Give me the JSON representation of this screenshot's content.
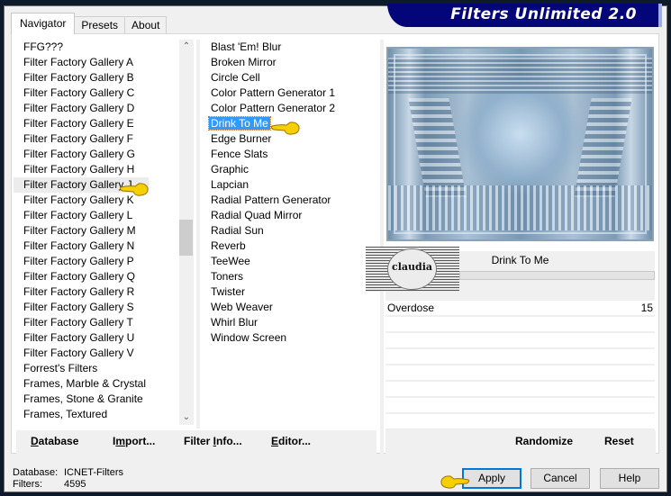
{
  "window": {
    "title": "Filters Unlimited 2.0"
  },
  "tabs": [
    {
      "label": "Navigator",
      "active": true
    },
    {
      "label": "Presets",
      "active": false
    },
    {
      "label": "About",
      "active": false
    }
  ],
  "categories": {
    "items": [
      "FFG???",
      "Filter Factory Gallery A",
      "Filter Factory Gallery B",
      "Filter Factory Gallery C",
      "Filter Factory Gallery D",
      "Filter Factory Gallery E",
      "Filter Factory Gallery F",
      "Filter Factory Gallery G",
      "Filter Factory Gallery H",
      "Filter Factory Gallery J",
      "Filter Factory Gallery K",
      "Filter Factory Gallery L",
      "Filter Factory Gallery M",
      "Filter Factory Gallery N",
      "Filter Factory Gallery P",
      "Filter Factory Gallery Q",
      "Filter Factory Gallery R",
      "Filter Factory Gallery S",
      "Filter Factory Gallery T",
      "Filter Factory Gallery U",
      "Filter Factory Gallery V",
      "Forrest's Filters",
      "Frames, Marble & Crystal",
      "Frames, Stone & Granite",
      "Frames, Textured"
    ],
    "highlighted": "Filter Factory Gallery J",
    "scroll_up_icon": "▲",
    "scroll_down_icon": "▼"
  },
  "filters": {
    "items": [
      "Blast 'Em! Blur",
      "Broken Mirror",
      "Circle Cell",
      "Color Pattern Generator 1",
      "Color Pattern Generator 2",
      "Drink To Me",
      "Edge Burner",
      "Fence Slats",
      "Graphic",
      "Lapcian",
      "Radial Pattern Generator",
      "Radial Quad Mirror",
      "Radial Sun",
      "Reverb",
      "TeeWee",
      "Toners",
      "Twister",
      "Web Weaver",
      "Whirl Blur",
      "Window Screen"
    ],
    "selected": "Drink To Me"
  },
  "watermark": {
    "text": "claudia"
  },
  "params": {
    "filter_name": "Drink To Me",
    "rows": [
      {
        "label": "Overdose",
        "value": "15"
      },
      {
        "label": "",
        "value": ""
      },
      {
        "label": "",
        "value": ""
      },
      {
        "label": "",
        "value": ""
      },
      {
        "label": "",
        "value": ""
      },
      {
        "label": "",
        "value": ""
      },
      {
        "label": "",
        "value": ""
      },
      {
        "label": "",
        "value": ""
      }
    ]
  },
  "toolbar_left": {
    "database": {
      "pre": "",
      "ul": "D",
      "post": "atabase"
    },
    "import": {
      "pre": "I",
      "ul": "m",
      "post": "port..."
    },
    "filter_info": {
      "pre": "Filter ",
      "ul": "I",
      "post": "nfo..."
    },
    "editor": {
      "pre": "",
      "ul": "E",
      "post": "ditor..."
    }
  },
  "toolbar_right": {
    "randomize": "Randomize",
    "reset": "Reset"
  },
  "status": {
    "database_label": "Database:",
    "database_value": "ICNET-Filters",
    "filters_label": "Filters:",
    "filters_value": "4595"
  },
  "buttons": {
    "apply": "Apply",
    "cancel": "Cancel",
    "help": "Help"
  },
  "colors": {
    "banner": "#05057a",
    "selection": "#3399ff",
    "default_button_border": "#0078d7",
    "pointer_hand": "#f5d000"
  }
}
